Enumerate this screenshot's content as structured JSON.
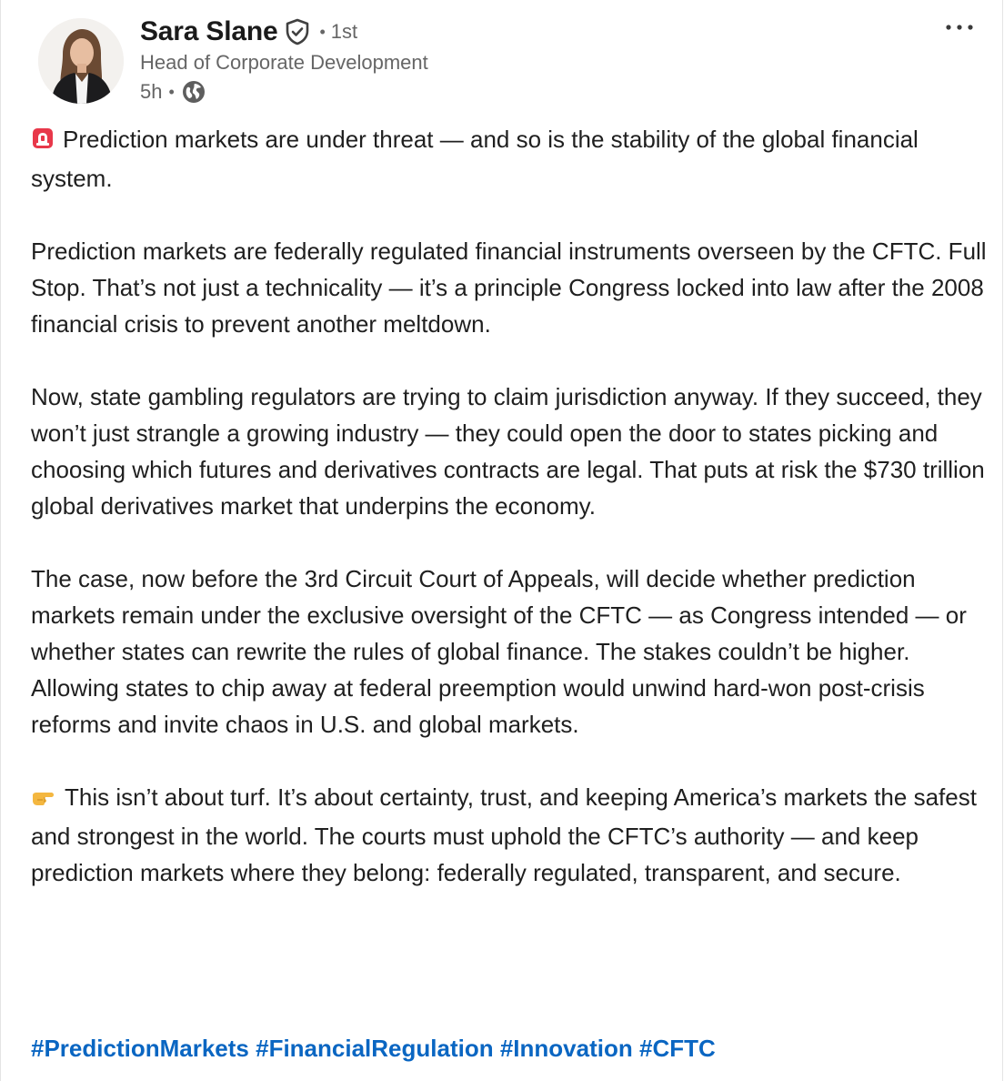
{
  "post": {
    "author": {
      "name": "Sara Slane",
      "degree": "1st",
      "headline": "Head of Corporate Development",
      "time": "5h"
    },
    "paragraphs": [
      "Prediction markets are under threat — and so is the stability of the global financial system.",
      "Prediction markets are federally regulated financial instruments overseen by the CFTC. Full Stop. That’s not just a technicality — it’s a principle Congress locked into law after the 2008 financial crisis to prevent another meltdown.",
      "Now, state gambling regulators are trying to claim jurisdiction anyway. If they succeed, they won’t just strangle a growing industry — they could open the door to states picking and choosing which futures and derivatives contracts are legal. That puts at risk the $730 trillion global derivatives market that underpins the economy.",
      "The case, now before the 3rd Circuit Court of Appeals, will decide whether prediction markets remain under the exclusive oversight of the CFTC — as Congress intended — or whether states can rewrite the rules of global finance. The stakes couldn’t be higher. Allowing states to chip away at federal preemption would unwind hard-won post-crisis reforms and invite chaos in U.S. and global markets.",
      "This isn’t about turf. It’s about certainty, trust, and keeping America’s markets the safest and strongest in the world. The courts must uphold the CFTC’s authority — and keep prediction markets where they belong: federally regulated, transparent, and secure."
    ],
    "hashtags": [
      "#PredictionMarkets",
      "#FinancialRegulation",
      "#Innovation",
      "#CFTC"
    ],
    "icons": {
      "verified": "verified-shield-icon",
      "visibility": "globe-icon",
      "menu": "more-options-icon",
      "alert": "rotating-light-emoji",
      "pointing": "backhand-index-pointing-right-emoji"
    },
    "colors": {
      "hashtag": "#0a66c2",
      "secondary_text": "#666666",
      "primary_text": "#1f1f1f"
    }
  }
}
